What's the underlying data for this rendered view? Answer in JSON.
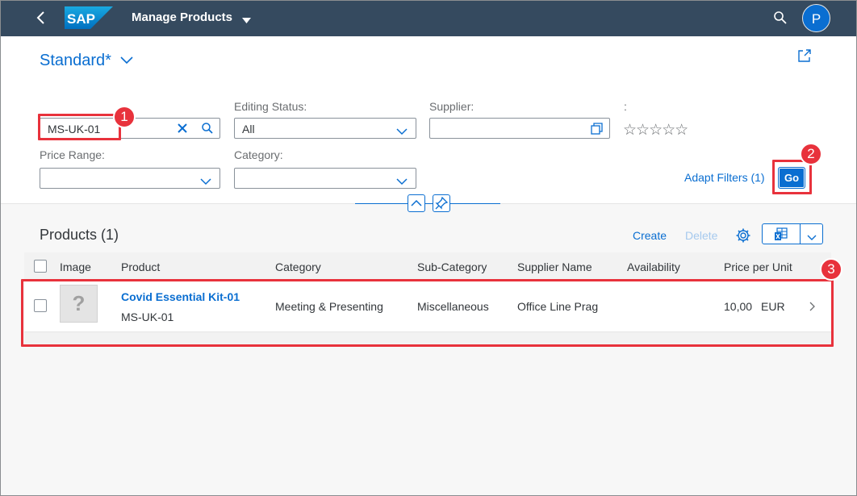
{
  "shell": {
    "logo_text": "SAP",
    "app_title": "Manage Products",
    "avatar_initial": "P"
  },
  "header": {
    "variant": "Standard*"
  },
  "filters": {
    "search_value": "MS-UK-01",
    "editing_status_label": "Editing Status:",
    "editing_status_value": "All",
    "supplier_label": "Supplier:",
    "supplier_value": "",
    "rating_label": ":",
    "rating_stars": "☆☆☆☆☆",
    "price_range_label": "Price Range:",
    "category_label": "Category:",
    "adapt_filters": "Adapt Filters (1)",
    "go_label": "Go"
  },
  "table": {
    "title": "Products (1)",
    "create_label": "Create",
    "delete_label": "Delete",
    "columns": [
      "Image",
      "Product",
      "Category",
      "Sub-Category",
      "Supplier Name",
      "Availability",
      "Price per Unit"
    ],
    "rows": [
      {
        "image_placeholder": "?",
        "product_name": "Covid Essential Kit-01",
        "product_id": "MS-UK-01",
        "category": "Meeting & Presenting",
        "sub_category": "Miscellaneous",
        "supplier_name": "Office Line Prag",
        "availability": "",
        "price": "10,00",
        "currency": "EUR"
      }
    ]
  },
  "annotations": [
    "1",
    "2",
    "3"
  ],
  "colors": {
    "shell_bg": "#354a5f",
    "accent": "#0a6ed1",
    "highlight": "#e8323c"
  }
}
